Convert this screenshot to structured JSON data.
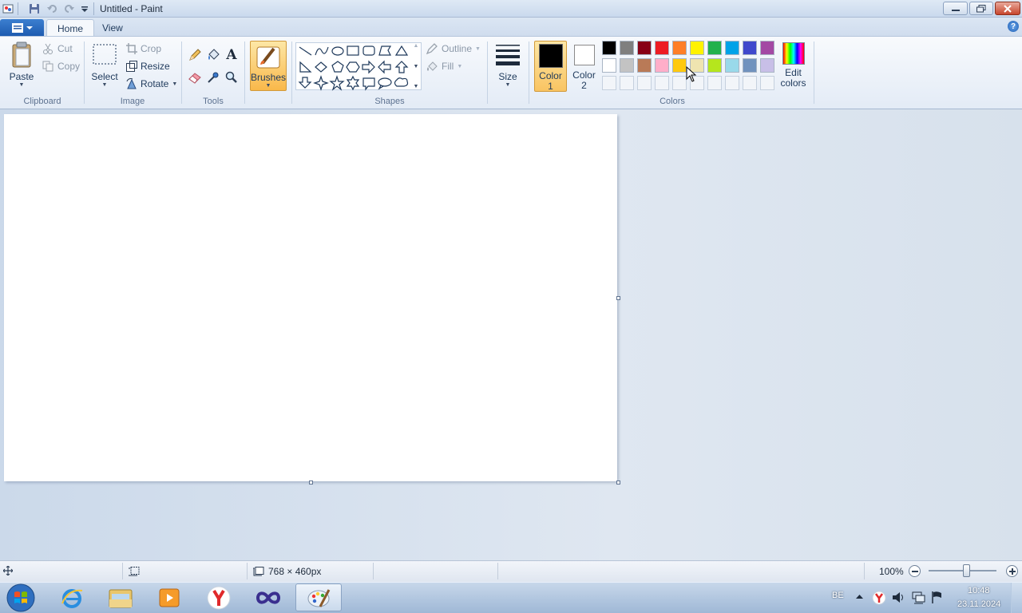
{
  "window": {
    "title": "Untitled - Paint"
  },
  "tabs": {
    "home": "Home",
    "view": "View"
  },
  "clipboard": {
    "paste": "Paste",
    "cut": "Cut",
    "copy": "Copy",
    "group": "Clipboard"
  },
  "image": {
    "select": "Select",
    "crop": "Crop",
    "resize": "Resize",
    "rotate": "Rotate",
    "group": "Image"
  },
  "tools": {
    "group": "Tools"
  },
  "brushes": {
    "label": "Brushes"
  },
  "shapes": {
    "outline": "Outline",
    "fill": "Fill",
    "group": "Shapes"
  },
  "size": {
    "label": "Size"
  },
  "colors": {
    "color1_line1": "Color",
    "color1_line2": "1",
    "color2_line1": "Color",
    "color2_line2": "2",
    "edit_line1": "Edit",
    "edit_line2": "colors",
    "group": "Colors",
    "color1_value": "#000000",
    "color2_value": "#ffffff",
    "row1": [
      "#000000",
      "#7f7f7f",
      "#880015",
      "#ed1c24",
      "#ff7f27",
      "#fff200",
      "#22b14c",
      "#00a2e8",
      "#3f48cc",
      "#a349a4"
    ],
    "row2": [
      "#ffffff",
      "#c3c3c3",
      "#b97a57",
      "#ffaec9",
      "#ffc90e",
      "#efe4b0",
      "#b5e61d",
      "#99d9ea",
      "#7092be",
      "#c8bfe7"
    ]
  },
  "status": {
    "canvas_size": "768 × 460px",
    "zoom": "100%"
  },
  "taskbar": {
    "lang": "BE",
    "time": "10:48",
    "date": "23.11.2024"
  }
}
